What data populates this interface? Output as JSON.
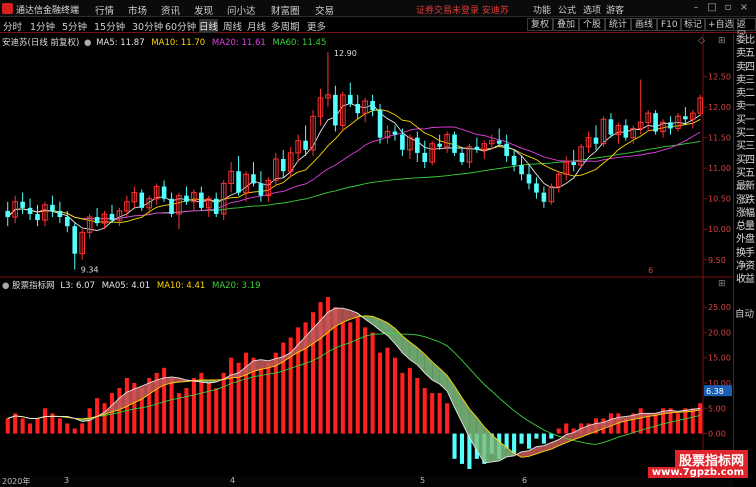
{
  "app": {
    "name": "通达信金融终端"
  },
  "menu": [
    "行情",
    "市场",
    "资讯",
    "发现",
    "问小达",
    "财富圈",
    "交易"
  ],
  "warning": "证券交易未登录  安迪苏",
  "topright": [
    "功能",
    "公式",
    "选项",
    "游客"
  ],
  "periods": [
    "分时",
    "1分钟",
    "5分钟",
    "15分钟",
    "30分钟",
    "60分钟",
    "日线",
    "周线",
    "月线",
    "多周期",
    "更多"
  ],
  "active_period": "日线",
  "toolbar": [
    "复权",
    "叠加",
    "个股",
    "统计",
    "画线",
    "F10",
    "标记",
    "+自选",
    "返回"
  ],
  "main_legend": {
    "title": "安迪苏(日线 前复权)",
    "ma": [
      {
        "label": "MA5: 11.87",
        "color": "#e6e6e6"
      },
      {
        "label": "MA10: 11.70",
        "color": "#ffd700"
      },
      {
        "label": "MA20: 11.61",
        "color": "#e040e0"
      },
      {
        "label": "MA60: 11.45",
        "color": "#3cd13c"
      }
    ]
  },
  "indicator_legend": {
    "title": "股票指标网",
    "items": [
      {
        "label": "L3: 6.07",
        "color": "#e6e6e6"
      },
      {
        "label": "MA05: 4.01",
        "color": "#e6e6e6"
      },
      {
        "label": "MA10: 4.41",
        "color": "#ffd700"
      },
      {
        "label": "MA20: 3.19",
        "color": "#3cd13c"
      }
    ]
  },
  "price_axis": [
    "12.50",
    "12.00",
    "11.50",
    "11.00",
    "10.50",
    "10.00",
    "9.50"
  ],
  "indicator_axis": [
    "25.00",
    "20.00",
    "15.00",
    "10.00",
    "5.00",
    "0.00"
  ],
  "annotations": {
    "high": "12.90",
    "low": "9.34",
    "current_value": "6.38",
    "month_marker": "6"
  },
  "date_labels": [
    "2020年",
    "3",
    "4",
    "5",
    "6"
  ],
  "right_panel": [
    "委比",
    "卖五",
    "卖四",
    "卖三",
    "卖二",
    "卖一",
    "买一",
    "买二",
    "买三",
    "买四",
    "买五",
    "最新",
    "涨跌",
    "涨幅",
    "总量",
    "外盘",
    "换手",
    "净资",
    "收益"
  ],
  "right_panel_auto": "自动",
  "watermark": {
    "line1": "股票指标网",
    "line2": "www.7gpzb.com"
  },
  "chart_data": {
    "type": "candlestick",
    "ohlc": [
      [
        10.3,
        10.45,
        10.05,
        10.2
      ],
      [
        10.2,
        10.55,
        10.1,
        10.45
      ],
      [
        10.45,
        10.6,
        10.25,
        10.35
      ],
      [
        10.35,
        10.5,
        10.15,
        10.25
      ],
      [
        10.25,
        10.4,
        10.05,
        10.15
      ],
      [
        10.15,
        10.45,
        10.05,
        10.4
      ],
      [
        10.4,
        10.55,
        10.2,
        10.3
      ],
      [
        10.3,
        10.45,
        10.1,
        10.2
      ],
      [
        10.2,
        10.3,
        9.95,
        10.05
      ],
      [
        10.05,
        10.1,
        9.34,
        9.6
      ],
      [
        9.6,
        10.0,
        9.5,
        9.95
      ],
      [
        9.95,
        10.25,
        9.85,
        10.2
      ],
      [
        10.2,
        10.35,
        10.05,
        10.1
      ],
      [
        10.1,
        10.3,
        10.0,
        10.25
      ],
      [
        10.25,
        10.4,
        10.1,
        10.15
      ],
      [
        10.15,
        10.35,
        10.05,
        10.3
      ],
      [
        10.3,
        10.55,
        10.2,
        10.45
      ],
      [
        10.45,
        10.7,
        10.35,
        10.6
      ],
      [
        10.6,
        10.65,
        10.3,
        10.35
      ],
      [
        10.35,
        10.55,
        10.25,
        10.5
      ],
      [
        10.5,
        10.75,
        10.4,
        10.7
      ],
      [
        10.7,
        10.8,
        10.45,
        10.5
      ],
      [
        10.5,
        10.6,
        10.2,
        10.25
      ],
      [
        10.25,
        10.6,
        10.0,
        10.55
      ],
      [
        10.55,
        10.7,
        10.4,
        10.45
      ],
      [
        10.45,
        10.65,
        10.3,
        10.6
      ],
      [
        10.6,
        10.7,
        10.3,
        10.35
      ],
      [
        10.35,
        10.55,
        10.2,
        10.5
      ],
      [
        10.5,
        10.6,
        10.2,
        10.25
      ],
      [
        10.25,
        10.8,
        10.15,
        10.75
      ],
      [
        10.75,
        11.1,
        10.6,
        10.95
      ],
      [
        10.95,
        11.2,
        10.55,
        10.6
      ],
      [
        10.6,
        10.95,
        10.45,
        10.9
      ],
      [
        10.9,
        11.1,
        10.7,
        10.75
      ],
      [
        10.75,
        10.95,
        10.45,
        10.55
      ],
      [
        10.55,
        10.85,
        10.45,
        10.8
      ],
      [
        10.8,
        11.25,
        10.7,
        11.15
      ],
      [
        11.15,
        11.3,
        10.85,
        10.95
      ],
      [
        10.95,
        11.35,
        10.85,
        11.25
      ],
      [
        11.25,
        11.55,
        11.1,
        11.45
      ],
      [
        11.45,
        11.7,
        11.2,
        11.3
      ],
      [
        11.3,
        11.95,
        11.2,
        11.85
      ],
      [
        11.85,
        12.3,
        11.7,
        12.15
      ],
      [
        12.15,
        12.9,
        12.0,
        12.2
      ],
      [
        12.2,
        12.35,
        11.6,
        11.7
      ],
      [
        11.7,
        12.25,
        11.6,
        12.2
      ],
      [
        12.2,
        12.4,
        12.0,
        12.05
      ],
      [
        12.05,
        12.2,
        11.8,
        11.9
      ],
      [
        11.9,
        12.15,
        11.75,
        12.1
      ],
      [
        12.1,
        12.2,
        11.85,
        11.95
      ],
      [
        11.95,
        12.05,
        11.4,
        11.5
      ],
      [
        11.5,
        11.7,
        11.4,
        11.6
      ],
      [
        11.6,
        11.7,
        11.45,
        11.55
      ],
      [
        11.55,
        11.65,
        11.2,
        11.3
      ],
      [
        11.3,
        11.55,
        11.15,
        11.5
      ],
      [
        11.5,
        11.6,
        11.1,
        11.25
      ],
      [
        11.25,
        11.45,
        11.0,
        11.1
      ],
      [
        11.1,
        11.45,
        11.05,
        11.4
      ],
      [
        11.4,
        11.55,
        11.3,
        11.35
      ],
      [
        11.35,
        11.6,
        11.25,
        11.55
      ],
      [
        11.55,
        11.6,
        11.2,
        11.25
      ],
      [
        11.25,
        11.35,
        11.05,
        11.1
      ],
      [
        11.1,
        11.4,
        11.0,
        11.35
      ],
      [
        11.35,
        11.5,
        11.25,
        11.3
      ],
      [
        11.3,
        11.45,
        11.15,
        11.4
      ],
      [
        11.4,
        11.55,
        11.3,
        11.45
      ],
      [
        11.45,
        11.65,
        11.35,
        11.4
      ],
      [
        11.4,
        11.55,
        11.1,
        11.2
      ],
      [
        11.2,
        11.3,
        10.95,
        11.05
      ],
      [
        11.05,
        11.2,
        10.8,
        10.9
      ],
      [
        10.9,
        11.05,
        10.65,
        10.75
      ],
      [
        10.75,
        10.85,
        10.5,
        10.6
      ],
      [
        10.6,
        10.7,
        10.35,
        10.45
      ],
      [
        10.45,
        10.75,
        10.4,
        10.7
      ],
      [
        10.7,
        10.95,
        10.6,
        10.9
      ],
      [
        10.9,
        11.2,
        10.8,
        11.1
      ],
      [
        11.1,
        11.3,
        10.95,
        11.05
      ],
      [
        11.05,
        11.4,
        11.0,
        11.35
      ],
      [
        11.35,
        11.6,
        11.25,
        11.5
      ],
      [
        11.5,
        11.7,
        11.3,
        11.4
      ],
      [
        11.4,
        11.85,
        11.35,
        11.8
      ],
      [
        11.8,
        11.9,
        11.5,
        11.55
      ],
      [
        11.55,
        11.75,
        11.4,
        11.7
      ],
      [
        11.7,
        11.8,
        11.45,
        11.5
      ],
      [
        11.5,
        11.7,
        11.4,
        11.65
      ],
      [
        11.65,
        12.45,
        11.55,
        11.75
      ],
      [
        11.75,
        11.95,
        11.6,
        11.9
      ],
      [
        11.9,
        11.95,
        11.55,
        11.6
      ],
      [
        11.6,
        11.8,
        11.5,
        11.75
      ],
      [
        11.75,
        11.85,
        11.55,
        11.65
      ],
      [
        11.65,
        11.9,
        11.6,
        11.85
      ],
      [
        11.85,
        12.0,
        11.7,
        11.8
      ],
      [
        11.8,
        11.95,
        11.65,
        11.9
      ],
      [
        11.9,
        12.2,
        11.85,
        12.15
      ]
    ],
    "indicator_bars": [
      3,
      4,
      3,
      2,
      3,
      5,
      4,
      3,
      2,
      1,
      2,
      5,
      7,
      6,
      8,
      9,
      11,
      10,
      9,
      11,
      12,
      13,
      11,
      8,
      9,
      11,
      12,
      10,
      9,
      12,
      15,
      14,
      16,
      15,
      13,
      14,
      16,
      18,
      19,
      21,
      22,
      24,
      26,
      27,
      25,
      22,
      22,
      23,
      21,
      20,
      16,
      17,
      15,
      12,
      13,
      11,
      9,
      8,
      8,
      6,
      -5,
      -6,
      -7,
      -5,
      -6,
      -4,
      -5,
      -3,
      -4,
      -2,
      -3,
      -1,
      -2,
      -1,
      1,
      2,
      1,
      2,
      2,
      3,
      3,
      4,
      4,
      3,
      4,
      5,
      4,
      4,
      5,
      5,
      4,
      5,
      5,
      6
    ],
    "price_range": [
      9.3,
      13.0
    ],
    "indicator_range": [
      -8,
      28
    ]
  }
}
